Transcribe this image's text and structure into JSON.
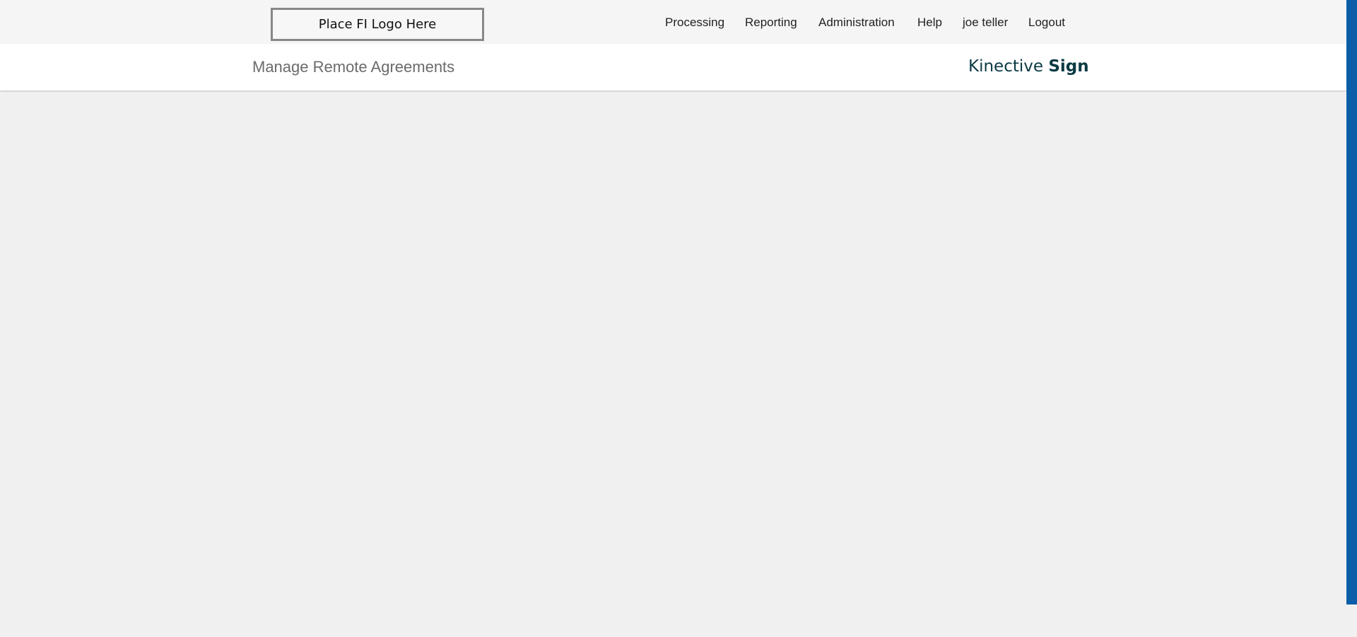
{
  "header": {
    "logo_placeholder": "Place FI Logo Here",
    "nav": [
      {
        "label": "Processing"
      },
      {
        "label": "Reporting"
      },
      {
        "label": "Administration"
      },
      {
        "label": "Help"
      },
      {
        "label": "joe teller"
      },
      {
        "label": "Logout"
      }
    ]
  },
  "sub_header": {
    "page_title": "Manage Remote Agreements",
    "brand_light": "Kinective",
    "brand_bold": "Sign"
  },
  "colors": {
    "top_bar_bg": "#f5f5f5",
    "sub_header_bg": "#ffffff",
    "main_bg": "#f0f0f0",
    "brand_color": "#0b3a44",
    "accent_bar": "#0a5ea8"
  }
}
